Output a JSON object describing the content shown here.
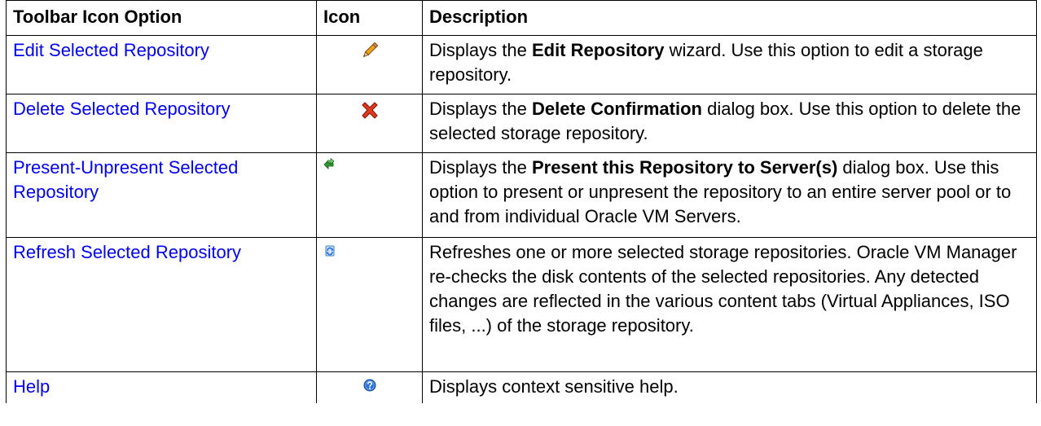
{
  "table": {
    "headers": {
      "option": "Toolbar Icon Option",
      "icon": "Icon",
      "description": "Description"
    },
    "rows": [
      {
        "option": "Edit Selected Repository",
        "icon": "pencil-icon",
        "desc_before": "Displays the ",
        "desc_bold": "Edit Repository",
        "desc_after": " wizard. Use this option to edit a storage repository."
      },
      {
        "option": "Delete Selected Repository",
        "icon": "red-x-icon",
        "desc_before": "Displays the ",
        "desc_bold": "Delete Confirmation",
        "desc_after": " dialog box. Use this option to delete the selected storage repository."
      },
      {
        "option": "Present-Unpresent Selected Repository",
        "icon": "green-arrows-icon",
        "desc_before": "Displays the ",
        "desc_bold": "Present this Repository to Server(s)",
        "desc_after": " dialog box. Use this option to present or unpresent the repository to an entire server pool or to and from individual Oracle VM Servers."
      },
      {
        "option": "Refresh Selected Repository",
        "icon": "refresh-icon",
        "desc_before": "Refreshes one or more selected storage repositories. Oracle VM Manager re-checks the disk contents of the selected repositories. Any detected changes are reflected in the various content tabs (Virtual Appliances, ISO files, ...) of the storage repository.",
        "desc_bold": "",
        "desc_after": ""
      },
      {
        "option": "Help",
        "icon": "help-icon",
        "desc_before": "Displays context sensitive help.",
        "desc_bold": "",
        "desc_after": ""
      }
    ]
  },
  "colors": {
    "link": "#0000ee",
    "border": "#000000",
    "delete_red": "#e03a1e",
    "present_green": "#2e9b2e",
    "refresh_blue": "#3b7fc4",
    "help_blue": "#2a6fd6"
  }
}
